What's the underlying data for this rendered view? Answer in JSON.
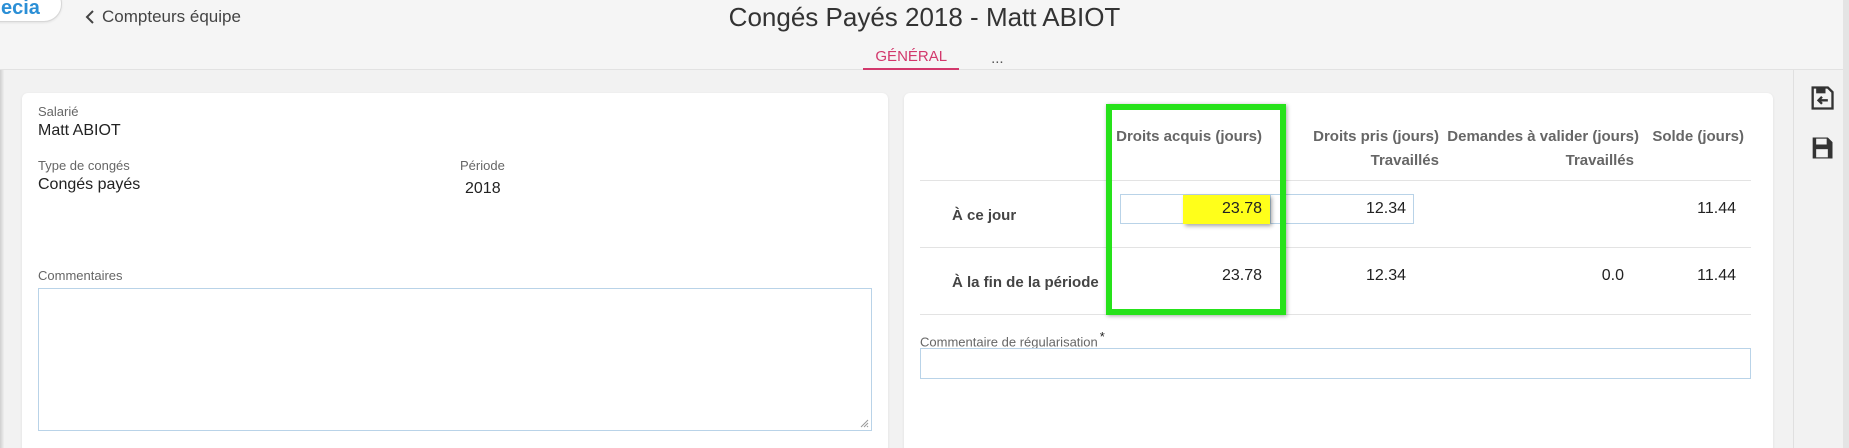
{
  "header": {
    "logo_text": "ecia",
    "back_label": "Compteurs équipe",
    "title": "Congés Payés 2018 - Matt ABIOT",
    "tabs": [
      {
        "label": "GÉNÉRAL",
        "active": true
      },
      {
        "label": "...",
        "active": false
      }
    ]
  },
  "form": {
    "salarie_label": "Salarié",
    "salarie_value": "Matt ABIOT",
    "type_label": "Type de congés",
    "type_value": "Congés payés",
    "periode_label": "Période",
    "periode_value": "2018",
    "commentaires_label": "Commentaires",
    "commentaires_value": ""
  },
  "table": {
    "headers": [
      {
        "line1": "Droits acquis (jours)",
        "line2": ""
      },
      {
        "line1": "Droits pris (jours)",
        "line2": "Travaillés"
      },
      {
        "line1": "Demandes à valider (jours)",
        "line2": "Travaillés"
      },
      {
        "line1": "Solde (jours)",
        "line2": ""
      }
    ],
    "rows": [
      {
        "label": "À ce jour",
        "acquis": "23.78",
        "pris": "12.34",
        "demandes": "",
        "solde": "11.44"
      },
      {
        "label": "À la fin de la période",
        "acquis": "23.78",
        "pris": "12.34",
        "demandes": "0.0",
        "solde": "11.44"
      }
    ],
    "regularisation_label": "Commentaire de régularisation",
    "regularisation_required": "*"
  },
  "colors": {
    "accent": "#d2386c",
    "highlight_box": "#26e21a",
    "highlight_field": "#ffff1a",
    "logo": "#2b8fd6"
  },
  "sidebar": {
    "icons": [
      "save-back-icon",
      "save-icon"
    ]
  }
}
